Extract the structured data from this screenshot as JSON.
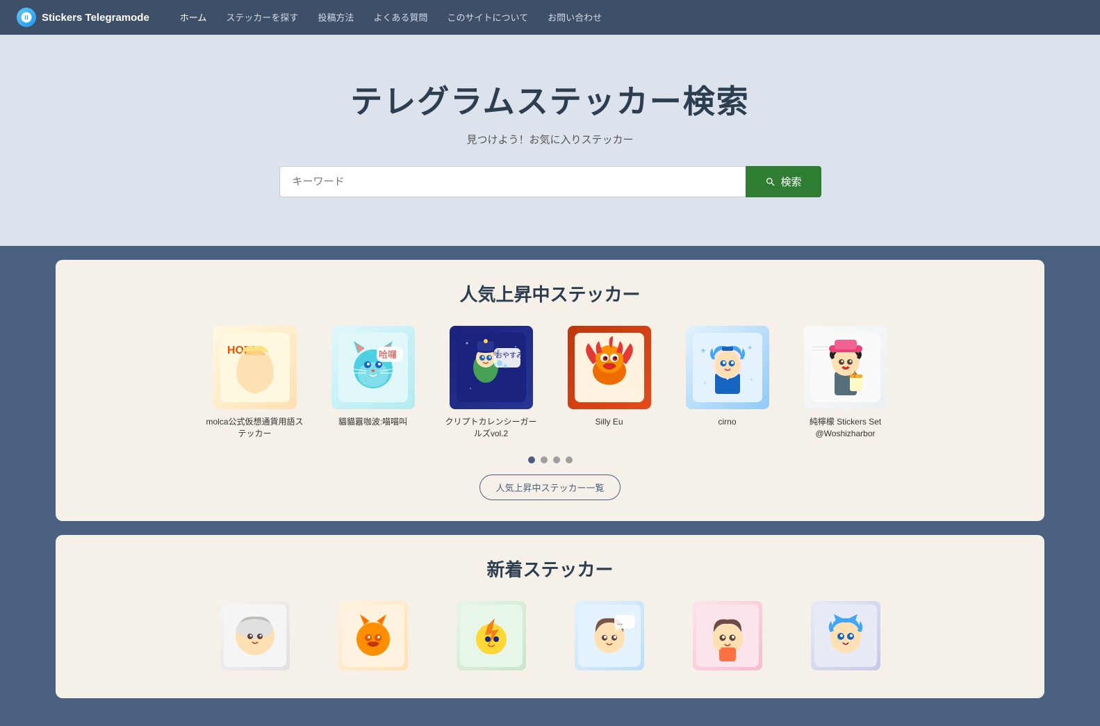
{
  "brand": {
    "name": "Stickers Telegramode",
    "icon": "🕊"
  },
  "nav": {
    "items": [
      {
        "label": "ホーム",
        "active": true
      },
      {
        "label": "ステッカーを探す",
        "active": false
      },
      {
        "label": "投稿方法",
        "active": false
      },
      {
        "label": "よくある質問",
        "active": false
      },
      {
        "label": "このサイトについて",
        "active": false
      },
      {
        "label": "お問い合わせ",
        "active": false
      }
    ]
  },
  "hero": {
    "title": "テレグラムステッカー検索",
    "subtitle": "見つけよう！お気に入りステッカー",
    "search_placeholder": "キーワード",
    "search_button": "検索"
  },
  "trending": {
    "section_title": "人気上昇中ステッカー",
    "view_all_label": "人気上昇中ステッカー一覧",
    "stickers": [
      {
        "label": "molca公式仮想通貨用語ステッカー",
        "emoji": "👧"
      },
      {
        "label": "貓貓囂咖波:喵喵叫",
        "emoji": "🐱"
      },
      {
        "label": "クリプトカレンシーガールズvol.2",
        "emoji": "🧙"
      },
      {
        "label": "Silly Eu",
        "emoji": "🐉"
      },
      {
        "label": "cirno",
        "emoji": "👧"
      },
      {
        "label": "純檸檬 Stickers Set @Woshizharbor",
        "emoji": "👩"
      }
    ],
    "dots": [
      {
        "active": true
      },
      {
        "active": false
      },
      {
        "active": false
      },
      {
        "active": false
      }
    ]
  },
  "new_stickers": {
    "section_title": "新着ステッカー",
    "stickers": [
      {
        "emoji": "🧕"
      },
      {
        "emoji": "🐱"
      },
      {
        "emoji": "⚡"
      },
      {
        "emoji": "💬"
      },
      {
        "emoji": "🙋"
      },
      {
        "emoji": "🐰"
      }
    ]
  }
}
